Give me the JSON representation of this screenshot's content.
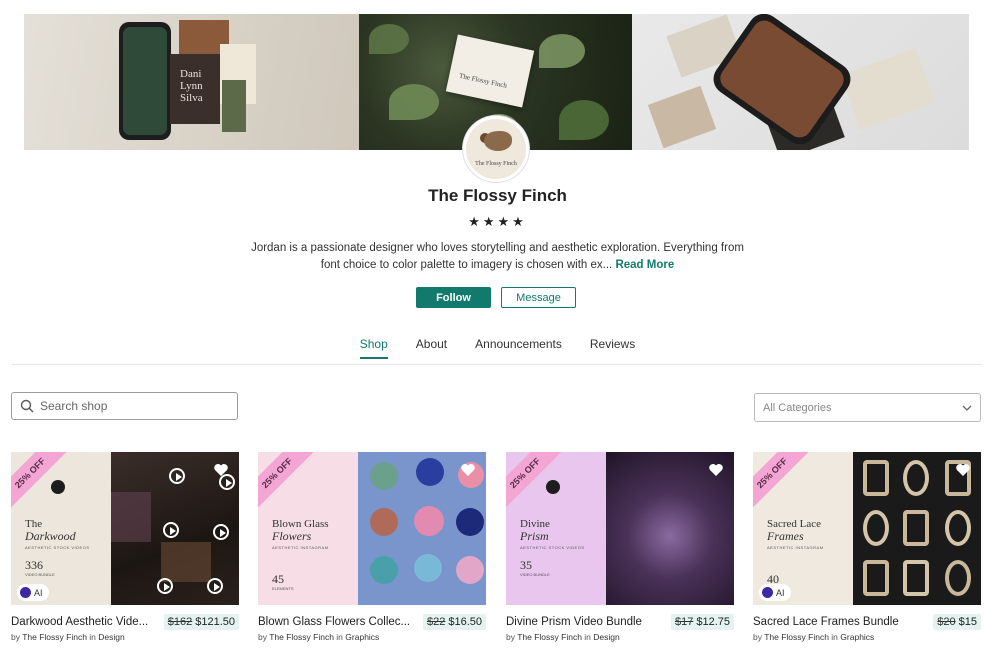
{
  "shop": {
    "name": "The Flossy Finch",
    "stars": "★★★★",
    "bio": "Jordan is a passionate designer who loves storytelling and aesthetic exploration. Everything from font choice to color palette to imagery is chosen with ex...",
    "read_more": "Read More",
    "follow_label": "Follow",
    "message_label": "Message",
    "avatar_text": "The Flossy Finch"
  },
  "banner": {
    "card_text": "Dani Lynn Silva",
    "postcard_text": "The Flossy Finch"
  },
  "tabs": [
    {
      "label": "Shop",
      "active": true
    },
    {
      "label": "About",
      "active": false
    },
    {
      "label": "Announcements",
      "active": false
    },
    {
      "label": "Reviews",
      "active": false
    }
  ],
  "search": {
    "placeholder": "Search shop"
  },
  "category": {
    "selected": "All Categories"
  },
  "colors": {
    "accent": "#117a6c",
    "ribbon": "#f3a6d4",
    "price_bg": "#e4f3ef"
  },
  "products": [
    {
      "title": "Darkwood Aesthetic Vide...",
      "old_price": "$162",
      "price": "$121.50",
      "by": "by",
      "shop": "The Flossy Finch",
      "in": "in",
      "category": "Design",
      "ribbon": "25% OFF",
      "ai": "AI",
      "cover_title": "The",
      "cover_title2": "Darkwood",
      "cover_sub": "AESTHETIC STOCK VIDEOS",
      "cover_num": "336",
      "cover_num_label": "VIDEO BUNDLE"
    },
    {
      "title": "Blown Glass Flowers Collec...",
      "old_price": "$22",
      "price": "$16.50",
      "by": "by",
      "shop": "The Flossy Finch",
      "in": "in",
      "category": "Graphics",
      "ribbon": "25% OFF",
      "cover_title": "Blown Glass",
      "cover_title2": "Flowers",
      "cover_sub": "AESTHETIC INSTAGRAM",
      "cover_num": "45",
      "cover_num_label": "ELEMENTS"
    },
    {
      "title": "Divine Prism Video Bundle",
      "old_price": "$17",
      "price": "$12.75",
      "by": "by",
      "shop": "The Flossy Finch",
      "in": "in",
      "category": "Design",
      "ribbon": "25% OFF",
      "cover_title": "Divine",
      "cover_title2": "Prism",
      "cover_sub": "AESTHETIC STOCK VIDEOS",
      "cover_num": "35",
      "cover_num_label": "VIDEO BUNDLE"
    },
    {
      "title": "Sacred Lace Frames Bundle",
      "old_price": "$20",
      "price": "$15",
      "by": "by",
      "shop": "The Flossy Finch",
      "in": "in",
      "category": "Graphics",
      "ribbon": "25% OFF",
      "ai": "AI",
      "cover_title": "Sacred Lace",
      "cover_title2": "Frames",
      "cover_sub": "AESTHETIC INSTAGRAM",
      "cover_num": "40",
      "cover_num_label": "ELEMENTS"
    }
  ]
}
